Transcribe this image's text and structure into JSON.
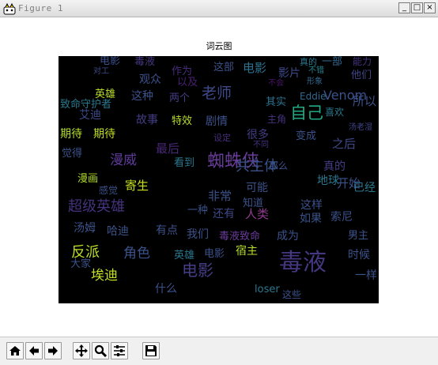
{
  "window": {
    "title": "Figure 1",
    "minimize": "_",
    "maximize": "□",
    "close": "×"
  },
  "figure": {
    "title": "词云图"
  },
  "words": [
    {
      "text": "电影",
      "color": "#3b4f8f",
      "size": 13
    },
    {
      "text": "毒液",
      "color": "#453781",
      "size": 13
    },
    {
      "text": "真的",
      "color": "#2a788e",
      "size": 11
    },
    {
      "text": "一部",
      "color": "#31688e",
      "size": 13
    },
    {
      "text": "能力",
      "color": "#46327e",
      "size": 12
    },
    {
      "text": "对工",
      "color": "#3e4a89",
      "size": 10
    },
    {
      "text": "作为",
      "color": "#472c7a",
      "size": 13
    },
    {
      "text": "这部",
      "color": "#3b528b",
      "size": 13
    },
    {
      "text": "电影",
      "color": "#2c728e",
      "size": 15
    },
    {
      "text": "不错",
      "color": "#26828e",
      "size": 10
    },
    {
      "text": "影片",
      "color": "#3e4989",
      "size": 14
    },
    {
      "text": "他们",
      "color": "#414487",
      "size": 13
    },
    {
      "text": "观众",
      "color": "#3b528b",
      "size": 14
    },
    {
      "text": "以及",
      "color": "#482173",
      "size": 13
    },
    {
      "text": "不会",
      "color": "#481668",
      "size": 10
    },
    {
      "text": "形象",
      "color": "#31688e",
      "size": 10
    },
    {
      "text": "英雄",
      "color": "#bddf26",
      "size": 13
    },
    {
      "text": "这种",
      "color": "#3b528b",
      "size": 14
    },
    {
      "text": "两个",
      "color": "#433e85",
      "size": 13
    },
    {
      "text": "老师",
      "color": "#3f4889",
      "size": 19
    },
    {
      "text": "其实",
      "color": "#2c728e",
      "size": 13
    },
    {
      "text": "Eddie",
      "color": "#31688e",
      "size": 12
    },
    {
      "text": "所以",
      "color": "#3b528b",
      "size": 15
    },
    {
      "text": "致命守护者",
      "color": "#2a788e",
      "size": 13
    },
    {
      "text": "艾迪",
      "color": "#3e4a89",
      "size": 14
    },
    {
      "text": "故事",
      "color": "#433e85",
      "size": 14
    },
    {
      "text": "特效",
      "color": "#b8de29",
      "size": 13
    },
    {
      "text": "剧情",
      "color": "#3b528b",
      "size": 14
    },
    {
      "text": "自己",
      "color": "#22a884",
      "size": 21
    },
    {
      "text": "主角",
      "color": "#46327e",
      "size": 12
    },
    {
      "text": "Venom",
      "color": "#3b528b",
      "size": 16
    },
    {
      "text": "喜欢",
      "color": "#2a788e",
      "size": 12
    },
    {
      "text": "期待",
      "color": "#b5de2b",
      "size": 14
    },
    {
      "text": "期待",
      "color": "#c2df23",
      "size": 14
    },
    {
      "text": "很多",
      "color": "#433e85",
      "size": 14
    },
    {
      "text": "变成",
      "color": "#3b528b",
      "size": 13
    },
    {
      "text": "之后",
      "color": "#3e4989",
      "size": 15
    },
    {
      "text": "最后",
      "color": "#482878",
      "size": 15
    },
    {
      "text": "漫威",
      "color": "#5e3c99",
      "size": 17
    },
    {
      "text": "设定",
      "color": "#472c7a",
      "size": 11
    },
    {
      "text": "不同",
      "color": "#46327e",
      "size": 10
    },
    {
      "text": "汤老湿",
      "color": "#414487",
      "size": 10
    },
    {
      "text": "觉得",
      "color": "#3b528b",
      "size": 13
    },
    {
      "text": "看到",
      "color": "#2a788e",
      "size": 13
    },
    {
      "text": "蜘蛛侠",
      "color": "#6a3d9a",
      "size": 22
    },
    {
      "text": "共生体",
      "color": "#3b528b",
      "size": 18
    },
    {
      "text": "那么",
      "color": "#3b528b",
      "size": 12
    },
    {
      "text": "真的",
      "color": "#433e85",
      "size": 14
    },
    {
      "text": "漫画",
      "color": "#b5de2b",
      "size": 13
    },
    {
      "text": "感觉",
      "color": "#3b528b",
      "size": 12
    },
    {
      "text": "寄生",
      "color": "#c8e020",
      "size": 15
    },
    {
      "text": "可能",
      "color": "#3b528b",
      "size": 14
    },
    {
      "text": "地球",
      "color": "#2a788e",
      "size": 14
    },
    {
      "text": "开始",
      "color": "#3b528b",
      "size": 15
    },
    {
      "text": "已经",
      "color": "#2a788e",
      "size": 14
    },
    {
      "text": "非常",
      "color": "#3b528b",
      "size": 15
    },
    {
      "text": "知道",
      "color": "#3b528b",
      "size": 13
    },
    {
      "text": "这样",
      "color": "#3b528b",
      "size": 14
    },
    {
      "text": "超级英雄",
      "color": "#46327e",
      "size": 18
    },
    {
      "text": "一种",
      "color": "#3b528b",
      "size": 13
    },
    {
      "text": "还有",
      "color": "#3e4989",
      "size": 14
    },
    {
      "text": "人类",
      "color": "#8e3a8c",
      "size": 15
    },
    {
      "text": "如果",
      "color": "#3b528b",
      "size": 14
    },
    {
      "text": "索尼",
      "color": "#3b528b",
      "size": 14
    },
    {
      "text": "汤姆",
      "color": "#3b528b",
      "size": 14
    },
    {
      "text": "哈迪",
      "color": "#3b528b",
      "size": 14
    },
    {
      "text": "有点",
      "color": "#3b528b",
      "size": 14
    },
    {
      "text": "我们",
      "color": "#3b528b",
      "size": 14
    },
    {
      "text": "毒液致命",
      "color": "#6a3d9a",
      "size": 13
    },
    {
      "text": "成为",
      "color": "#3b528b",
      "size": 14
    },
    {
      "text": "男主",
      "color": "#3b528b",
      "size": 13
    },
    {
      "text": "反派",
      "color": "#bddf26",
      "size": 18
    },
    {
      "text": "角色",
      "color": "#3b528b",
      "size": 17
    },
    {
      "text": "英雄",
      "color": "#2a788e",
      "size": 13
    },
    {
      "text": "电影",
      "color": "#3b528b",
      "size": 13
    },
    {
      "text": "宿主",
      "color": "#b5de2b",
      "size": 14
    },
    {
      "text": "毒液",
      "color": "#453781",
      "size": 30
    },
    {
      "text": "时候",
      "color": "#3b528b",
      "size": 14
    },
    {
      "text": "大家",
      "color": "#3b528b",
      "size": 13
    },
    {
      "text": "埃迪",
      "color": "#c2df23",
      "size": 17
    },
    {
      "text": "电影",
      "color": "#433e85",
      "size": 20
    },
    {
      "text": "一样",
      "color": "#3b528b",
      "size": 14
    },
    {
      "text": "什么",
      "color": "#3b528b",
      "size": 14
    },
    {
      "text": "loser",
      "color": "#2a788e",
      "size": 13
    },
    {
      "text": "这些",
      "color": "#3b528b",
      "size": 12
    }
  ],
  "toolbar": {
    "home": "home-icon",
    "back": "arrow-left-icon",
    "forward": "arrow-right-icon",
    "pan": "move-icon",
    "zoom": "magnifier-icon",
    "configure": "sliders-icon",
    "save": "floppy-icon"
  }
}
